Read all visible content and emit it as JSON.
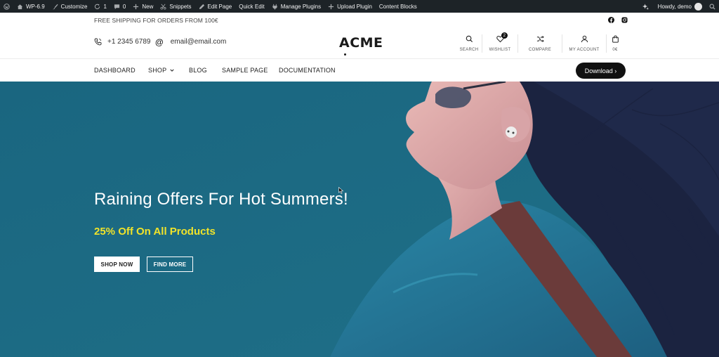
{
  "adminbar": {
    "site": "WP-6.9",
    "customize": "Customize",
    "updates": "1",
    "comments": "0",
    "new": "New",
    "snippets": "Snippets",
    "edit_page": "Edit Page",
    "quick_edit": "Quick Edit",
    "manage_plugins": "Manage Plugins",
    "upload_plugin": "Upload Plugin",
    "content_blocks": "Content Blocks",
    "howdy": "Howdy, demo"
  },
  "topstrip": {
    "shipping": "FREE SHIPPING FOR ORDERS FROM 100€"
  },
  "header": {
    "phone": "+1 2345 6789",
    "email": "email@email.com",
    "logo": "ACME",
    "search_label": "SEARCH",
    "wishlist_label": "WISHLIST",
    "wishlist_count": "2",
    "compare_label": "COMPARE",
    "account_label": "MY ACCOUNT",
    "cart_total": "0€"
  },
  "nav": {
    "items": [
      "DASHBOARD",
      "SHOP",
      "BLOG",
      "SAMPLE PAGE",
      "DOCUMENTATION"
    ],
    "download": "Download ›"
  },
  "hero": {
    "title": "Raining Offers For Hot Summers!",
    "subtitle": "25% Off On All Products",
    "shop_now": "SHOP NOW",
    "find_more": "FIND MORE"
  },
  "colors": {
    "hero_bg": "#1d6b83",
    "accent_yellow": "#f0e32a",
    "admin_bar": "#1d2327"
  }
}
